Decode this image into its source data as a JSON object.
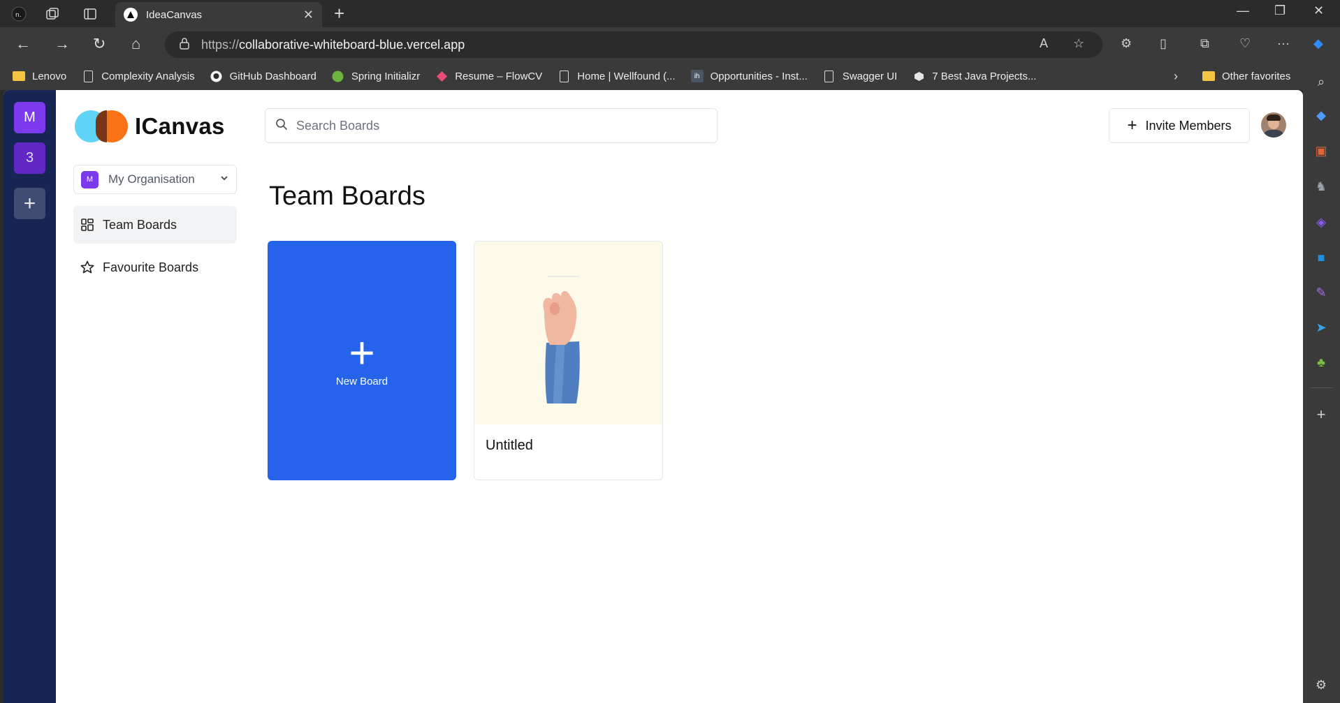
{
  "browser": {
    "tab_title": "IdeaCanvas",
    "url_prefix": "https://",
    "url_host": "collaborative-whiteboard-blue.vercel.app",
    "favorites": [
      {
        "label": "Lenovo",
        "icon": "folder-icon"
      },
      {
        "label": "Complexity Analysis",
        "icon": "page-icon"
      },
      {
        "label": "GitHub Dashboard",
        "icon": "github-icon"
      },
      {
        "label": "Spring Initializr",
        "icon": "spring-icon"
      },
      {
        "label": "Resume – FlowCV",
        "icon": "flowcv-icon"
      },
      {
        "label": "Home | Wellfound (...",
        "icon": "page-icon"
      },
      {
        "label": "Opportunities - Inst...",
        "icon": "ih-icon"
      },
      {
        "label": "Swagger UI",
        "icon": "page-icon"
      },
      {
        "label": "7 Best Java Projects...",
        "icon": "hex-icon"
      }
    ],
    "other_favorites": "Other favorites"
  },
  "org_rail": {
    "orgs": [
      {
        "letter": "M",
        "color": "#7c3aed"
      },
      {
        "letter": "3",
        "color": "#6d28d9"
      }
    ]
  },
  "app": {
    "logo_text": "ICanvas",
    "org_switcher": {
      "badge": "M",
      "name": "My Organisation"
    },
    "nav": {
      "team_boards": "Team Boards",
      "favourite_boards": "Favourite Boards"
    },
    "search": {
      "placeholder": "Search Boards"
    },
    "invite_label": "Invite Members",
    "page_title": "Team Boards",
    "new_board_label": "New Board",
    "boards": [
      {
        "title": "Untitled"
      }
    ]
  },
  "colors": {
    "rail": "#172554",
    "new_board": "#2563eb",
    "board_thumb_bg": "#fdfaea"
  }
}
